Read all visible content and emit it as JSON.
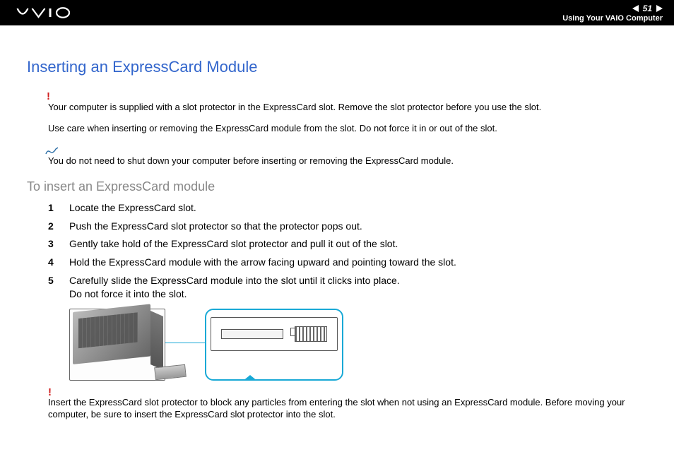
{
  "header": {
    "page_number": "51",
    "section": "Using Your VAIO Computer"
  },
  "title": "Inserting an ExpressCard Module",
  "warning1": "Your computer is supplied with a slot protector in the ExpressCard slot. Remove the slot protector before you use the slot.",
  "caution": "Use care when inserting or removing the ExpressCard module from the slot. Do not force it in or out of the slot.",
  "note": "You do not need to shut down your computer before inserting or removing the ExpressCard module.",
  "subhead": "To insert an ExpressCard module",
  "steps": [
    {
      "n": "1",
      "text": "Locate the ExpressCard slot."
    },
    {
      "n": "2",
      "text": "Push the ExpressCard slot protector so that the protector pops out."
    },
    {
      "n": "3",
      "text": "Gently take hold of the ExpressCard slot protector and pull it out of the slot."
    },
    {
      "n": "4",
      "text": "Hold the ExpressCard module with the arrow facing upward and pointing toward the slot."
    },
    {
      "n": "5",
      "text": "Carefully slide the ExpressCard module into the slot until it clicks into place.\nDo not force it into the slot."
    }
  ],
  "warning2": "Insert the ExpressCard slot protector to block any particles from entering the slot when not using an ExpressCard module. Before moving your computer, be sure to insert the ExpressCard slot protector into the slot."
}
